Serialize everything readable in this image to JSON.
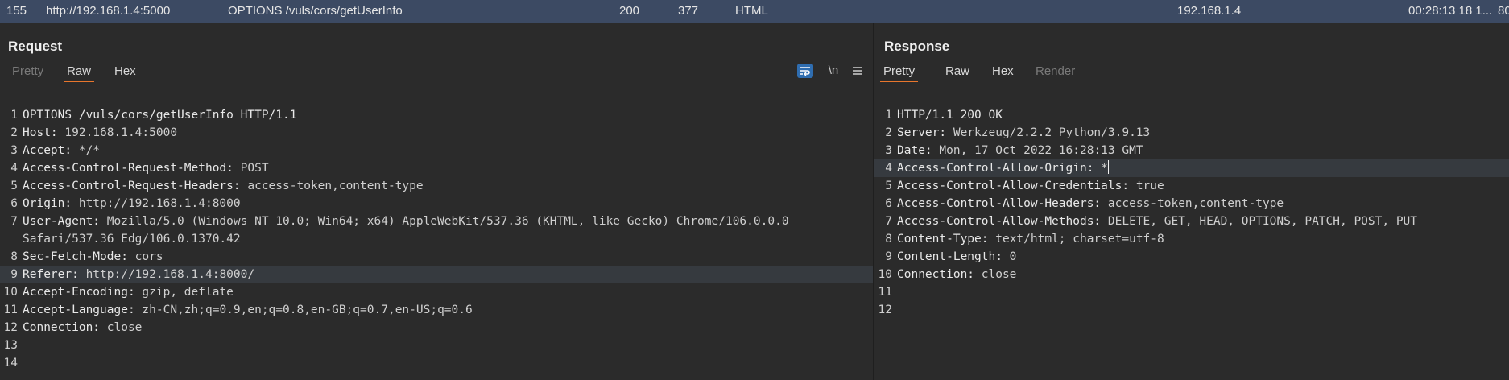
{
  "history_row": {
    "index": "155",
    "host": "http://192.168.1.4:5000",
    "method_path": "OPTIONS  /vuls/cors/getUserInfo",
    "status": "200",
    "length": "377",
    "mime": "HTML",
    "ip": "192.168.1.4",
    "time": "00:28:13 18 1...",
    "port": "80"
  },
  "request": {
    "title": "Request",
    "tabs": [
      {
        "label": "Pretty",
        "state": "disabled"
      },
      {
        "label": "Raw",
        "state": "active"
      },
      {
        "label": "Hex",
        "state": "normal"
      }
    ],
    "tools": {
      "newline_label": "\\n",
      "menu_icon": "hamburger-menu-icon",
      "wrap_icon": "wrap-lines-icon"
    },
    "lines": [
      {
        "num": "1",
        "name": "OPTIONS /vuls/cors/getUserInfo HTTP/1.1",
        "value": ""
      },
      {
        "num": "2",
        "name": "Host:",
        "value": " 192.168.1.4:5000"
      },
      {
        "num": "3",
        "name": "Accept:",
        "value": " */*"
      },
      {
        "num": "4",
        "name": "Access-Control-Request-Method:",
        "value": " POST"
      },
      {
        "num": "5",
        "name": "Access-Control-Request-Headers:",
        "value": " access-token,content-type"
      },
      {
        "num": "6",
        "name": "Origin:",
        "value": " http://192.168.1.4:8000"
      },
      {
        "num": "7",
        "name": "User-Agent:",
        "value": " Mozilla/5.0 (Windows NT 10.0; Win64; x64) AppleWebKit/537.36 (KHTML, like Gecko) Chrome/106.0.0.0"
      },
      {
        "num": "",
        "name": "",
        "value": "Safari/537.36 Edg/106.0.1370.42"
      },
      {
        "num": "8",
        "name": "Sec-Fetch-Mode:",
        "value": " cors"
      },
      {
        "num": "9",
        "name": "Referer:",
        "value": " http://192.168.1.4:8000/"
      },
      {
        "num": "10",
        "name": "Accept-Encoding:",
        "value": " gzip, deflate"
      },
      {
        "num": "11",
        "name": "Accept-Language:",
        "value": " zh-CN,zh;q=0.9,en;q=0.8,en-GB;q=0.7,en-US;q=0.6"
      },
      {
        "num": "12",
        "name": "Connection:",
        "value": " close"
      },
      {
        "num": "13",
        "name": "",
        "value": ""
      },
      {
        "num": "14",
        "name": "",
        "value": ""
      }
    ]
  },
  "response": {
    "title": "Response",
    "tabs": [
      {
        "label": "Pretty",
        "state": "active"
      },
      {
        "label": "Raw",
        "state": "normal"
      },
      {
        "label": "Hex",
        "state": "normal"
      },
      {
        "label": "Render",
        "state": "disabled"
      }
    ],
    "lines": [
      {
        "num": "1",
        "name": "HTTP/1.1 200 OK",
        "value": ""
      },
      {
        "num": "2",
        "name": "Server:",
        "value": " Werkzeug/2.2.2 Python/3.9.13"
      },
      {
        "num": "3",
        "name": "Date:",
        "value": " Mon, 17 Oct 2022 16:28:13 GMT"
      },
      {
        "num": "4",
        "name": "Access-Control-Allow-Origin:",
        "value": " *"
      },
      {
        "num": "5",
        "name": "Access-Control-Allow-Credentials:",
        "value": " true"
      },
      {
        "num": "6",
        "name": "Access-Control-Allow-Headers:",
        "value": " access-token,content-type"
      },
      {
        "num": "7",
        "name": "Access-Control-Allow-Methods:",
        "value": " DELETE, GET, HEAD, OPTIONS, PATCH, POST, PUT"
      },
      {
        "num": "8",
        "name": "Content-Type:",
        "value": " text/html; charset=utf-8"
      },
      {
        "num": "9",
        "name": "Content-Length:",
        "value": " 0"
      },
      {
        "num": "10",
        "name": "Connection:",
        "value": " close"
      },
      {
        "num": "11",
        "name": "",
        "value": ""
      },
      {
        "num": "12",
        "name": "",
        "value": ""
      }
    ]
  },
  "colors": {
    "accent_tab_underline": "#e8762d",
    "selected_row": "#3c4a63",
    "wrap_button": "#2f6db0"
  }
}
